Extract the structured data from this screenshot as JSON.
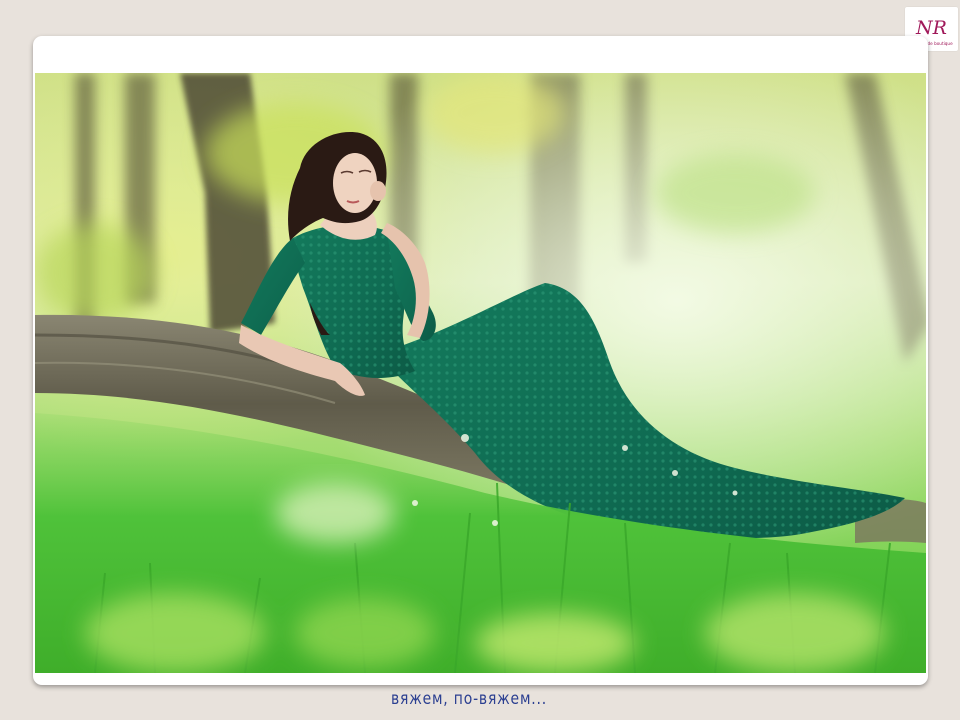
{
  "logo": {
    "monogram": "NR",
    "tagline": "handmade boutique",
    "color": "#a0195a"
  },
  "photo": {
    "subject": "woman-in-lace-gown",
    "palette": {
      "grass": "#4fc23a",
      "foliage": "#b6d86a",
      "dress": "#0f6b52",
      "trunk": "#6e6a58",
      "hair": "#2a1a14"
    }
  },
  "caption": {
    "text": "вяжем, по-вяжем...",
    "color": "#2b3f91"
  }
}
